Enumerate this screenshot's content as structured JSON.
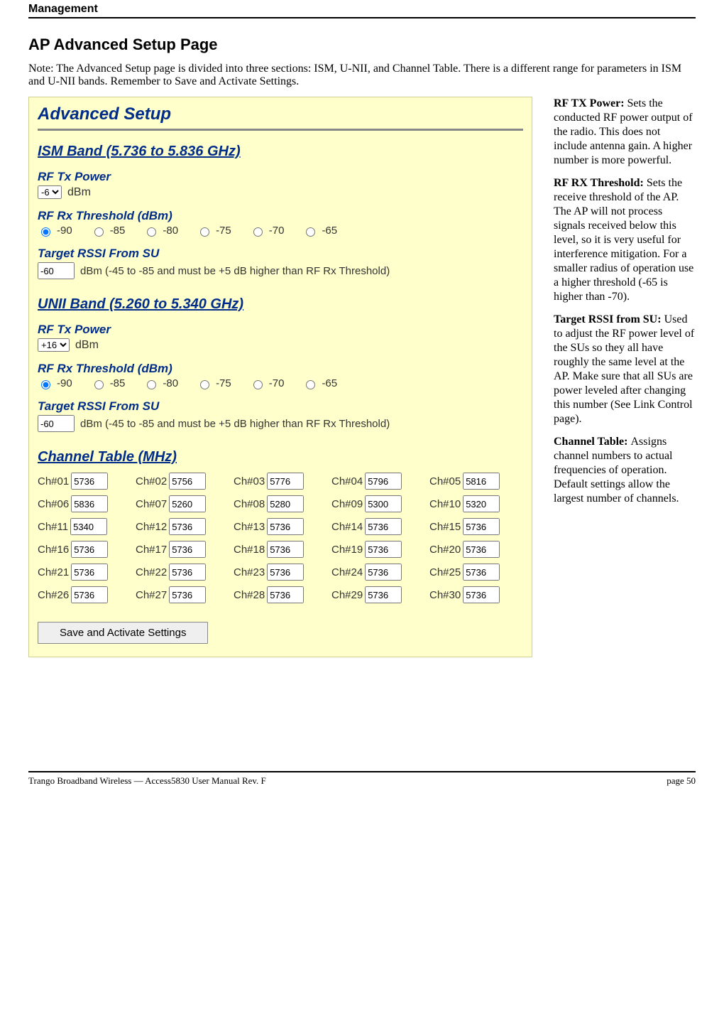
{
  "header": "Management",
  "title": "AP Advanced Setup Page",
  "note": "Note: The Advanced Setup page is divided into three sections:  ISM, U-NII, and Channel Table.  There is a different range for parameters in ISM and U-NII bands.  Remember to Save and Activate Settings.",
  "panel": {
    "title": "Advanced Setup",
    "ism": {
      "section": "ISM Band (5.736 to 5.836 GHz)",
      "txLabel": "RF Tx Power",
      "txVal": "-6",
      "txUnit": "dBm",
      "rxLabel": "RF Rx Threshold (dBm)",
      "rxOptions": [
        "-90",
        "-85",
        "-80",
        "-75",
        "-70",
        "-65"
      ],
      "rxSel": "-90",
      "rssiLabel": "Target RSSI From SU",
      "rssiVal": "-60",
      "rssiHint": "dBm    (-45 to -85 and must be +5 dB higher than RF Rx Threshold)"
    },
    "unii": {
      "section": "UNII Band (5.260 to 5.340 GHz)",
      "txLabel": "RF Tx Power",
      "txVal": "+16",
      "txUnit": "dBm",
      "rxLabel": "RF Rx Threshold (dBm)",
      "rxOptions": [
        "-90",
        "-85",
        "-80",
        "-75",
        "-70",
        "-65"
      ],
      "rxSel": "-90",
      "rssiLabel": "Target RSSI From SU",
      "rssiVal": "-60",
      "rssiHint": "dBm    (-45 to -85 and must be +5 dB higher than RF Rx Threshold)"
    },
    "chSection": "Channel Table (MHz)",
    "channels": [
      {
        "n": "Ch#01",
        "v": "5736"
      },
      {
        "n": "Ch#02",
        "v": "5756"
      },
      {
        "n": "Ch#03",
        "v": "5776"
      },
      {
        "n": "Ch#04",
        "v": "5796"
      },
      {
        "n": "Ch#05",
        "v": "5816"
      },
      {
        "n": "Ch#06",
        "v": "5836"
      },
      {
        "n": "Ch#07",
        "v": "5260"
      },
      {
        "n": "Ch#08",
        "v": "5280"
      },
      {
        "n": "Ch#09",
        "v": "5300"
      },
      {
        "n": "Ch#10",
        "v": "5320"
      },
      {
        "n": "Ch#11",
        "v": "5340"
      },
      {
        "n": "Ch#12",
        "v": "5736"
      },
      {
        "n": "Ch#13",
        "v": "5736"
      },
      {
        "n": "Ch#14",
        "v": "5736"
      },
      {
        "n": "Ch#15",
        "v": "5736"
      },
      {
        "n": "Ch#16",
        "v": "5736"
      },
      {
        "n": "Ch#17",
        "v": "5736"
      },
      {
        "n": "Ch#18",
        "v": "5736"
      },
      {
        "n": "Ch#19",
        "v": "5736"
      },
      {
        "n": "Ch#20",
        "v": "5736"
      },
      {
        "n": "Ch#21",
        "v": "5736"
      },
      {
        "n": "Ch#22",
        "v": "5736"
      },
      {
        "n": "Ch#23",
        "v": "5736"
      },
      {
        "n": "Ch#24",
        "v": "5736"
      },
      {
        "n": "Ch#25",
        "v": "5736"
      },
      {
        "n": "Ch#26",
        "v": "5736"
      },
      {
        "n": "Ch#27",
        "v": "5736"
      },
      {
        "n": "Ch#28",
        "v": "5736"
      },
      {
        "n": "Ch#29",
        "v": "5736"
      },
      {
        "n": "Ch#30",
        "v": "5736"
      }
    ],
    "save": "Save and Activate Settings"
  },
  "side": {
    "p1b": "RF TX Power:  ",
    "p1": "Sets the conducted RF power output of the radio.  This does not include antenna gain.  A higher number is more powerful.",
    "p2b": "RF RX Threshold: ",
    "p2": "Sets the receive threshold of the AP.  The AP will not process signals received below this level, so it is very useful for interference mitigation.  For a smaller radius of operation use a higher threshold (-65 is higher than -70).",
    "p3b": "Target RSSI from SU: ",
    "p3": "Used to adjust the RF power level of the SUs so they all have roughly the same level at the AP.  Make sure that all SUs are power leveled after changing this number (See Link Control page).",
    "p4b": "Channel Table: ",
    "p4": "Assigns channel numbers to actual frequencies of operation.  Default settings allow the largest number of channels."
  },
  "footer": {
    "left": "Trango Broadband Wireless — Access5830 User Manual  Rev. F",
    "right": "page 50"
  }
}
